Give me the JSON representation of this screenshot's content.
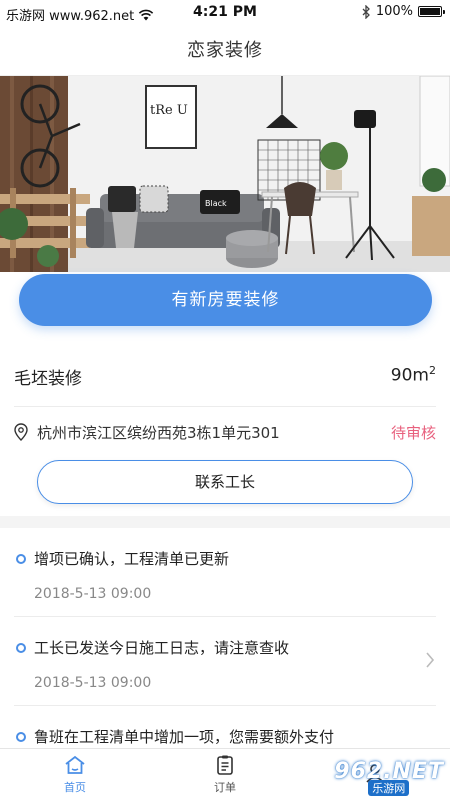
{
  "status_bar": {
    "carrier": "乐游网 www.962.net",
    "time": "4:21 PM",
    "battery": "100%"
  },
  "nav": {
    "title": "恋家装修"
  },
  "hero": {
    "poster_text": "tRe U",
    "cushion_text": "Black"
  },
  "cta": {
    "label": "有新房要装修"
  },
  "project": {
    "type": "毛坯装修",
    "area": "90m",
    "area_unit_sup": "2",
    "address": "杭州市滨江区缤纷西苑3栋1单元301",
    "status": "待审核",
    "status_color": "#e8617e",
    "contact_label": "联系工长"
  },
  "feed": [
    {
      "text": "增项已确认，工程清单已更新",
      "time": "2018-5-13 09:00",
      "has_chevron": false
    },
    {
      "text": "工长已发送今日施工日志，请注意查收",
      "time": "2018-5-13 09:00",
      "has_chevron": true
    },
    {
      "text": "鲁班在工程清单中增加一项，您需要额外支付",
      "time": "",
      "has_chevron": false
    }
  ],
  "tabs": [
    {
      "label": "首页",
      "icon": "home-icon",
      "active": true
    },
    {
      "label": "订单",
      "icon": "order-icon",
      "active": false
    },
    {
      "label": "",
      "icon": "profile-icon",
      "active": false
    }
  ],
  "watermark": {
    "main": "962.NET",
    "sub": "乐游网"
  },
  "colors": {
    "accent": "#4a8ee6",
    "status_pending": "#e8617e"
  }
}
